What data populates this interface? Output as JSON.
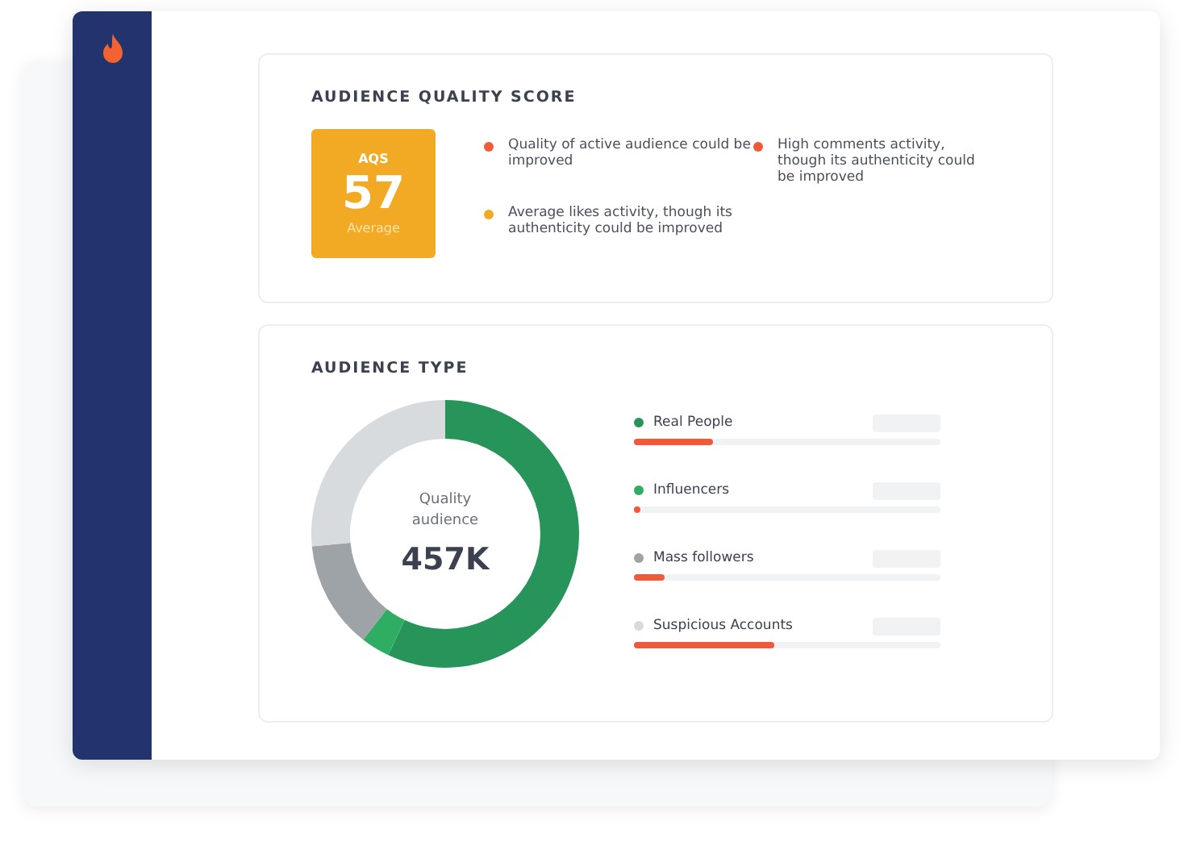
{
  "score_card": {
    "title": "AUDIENCE QUALITY SCORE",
    "badge": {
      "label": "AQS",
      "value": "57",
      "rating": "Average"
    },
    "notes": [
      {
        "text": "Quality of active audience could be improved",
        "color": "#ef5b38"
      },
      {
        "text": "High comments activity, though its authenticity could be improved",
        "color": "#ef5b38"
      },
      {
        "text": "Average likes activity, though its authenticity could be improved",
        "color": "#f2a924"
      }
    ]
  },
  "type_card": {
    "title": "AUDIENCE TYPE",
    "donut": {
      "caption": "Quality audience",
      "value": "457K"
    },
    "segments": [
      {
        "name": "Real People",
        "color": "#27955a",
        "level": 0.26
      },
      {
        "name": "Influencers",
        "color": "#2fae63",
        "level": 0.02
      },
      {
        "name": "Mass followers",
        "color": "#9ea3a8",
        "level": 0.1
      },
      {
        "name": "Suspicious Accounts",
        "color": "#d8dbde",
        "level": 0.46
      }
    ]
  }
}
